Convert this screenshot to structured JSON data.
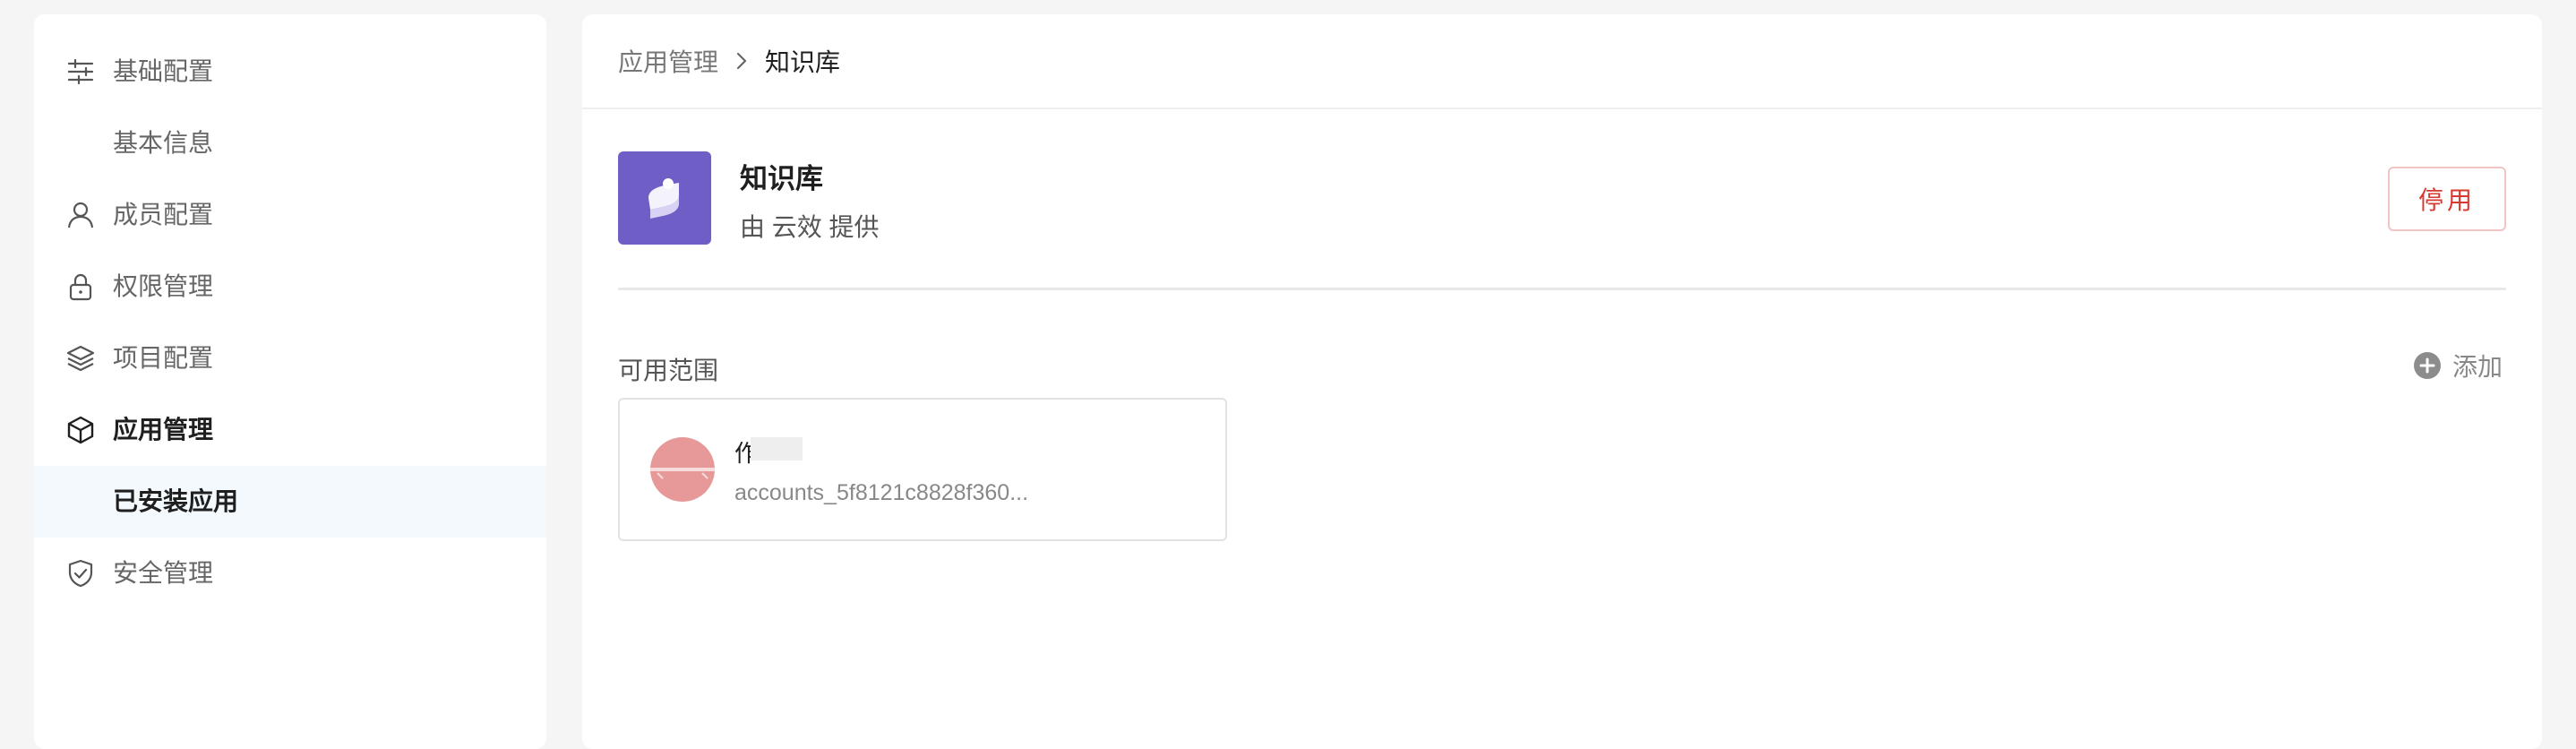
{
  "sidebar": {
    "items": [
      {
        "label": "基础配置",
        "icon": "sliders-icon"
      },
      {
        "label": "基本信息",
        "icon": ""
      },
      {
        "label": "成员配置",
        "icon": "user-icon"
      },
      {
        "label": "权限管理",
        "icon": "lock-icon"
      },
      {
        "label": "项目配置",
        "icon": "layers-icon"
      },
      {
        "label": "应用管理",
        "icon": "cube-icon"
      },
      {
        "label": "已安装应用",
        "icon": ""
      },
      {
        "label": "安全管理",
        "icon": "shield-check-icon"
      }
    ]
  },
  "breadcrumb": {
    "parent": "应用管理",
    "current": "知识库"
  },
  "app": {
    "name": "知识库",
    "provider": "由 云效 提供",
    "disable_label": "停用",
    "logo_color": "#6f5ec5"
  },
  "scope": {
    "title": "可用范围",
    "add_label": "添加",
    "members": [
      {
        "name": "作",
        "account": "accounts_5f8121c8828f360..."
      }
    ]
  },
  "colors": {
    "accent_danger": "#d9382f",
    "selected_bg": "#f3f9fc",
    "avatar": "#e79999"
  }
}
